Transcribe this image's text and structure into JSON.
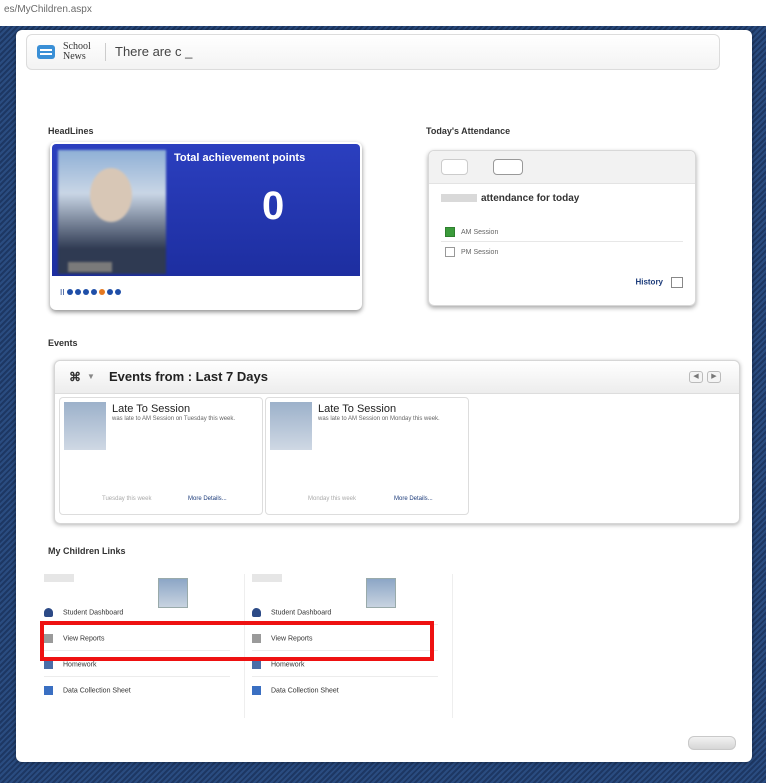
{
  "browser": {
    "url": "es/MyChildren.aspx"
  },
  "school_news": {
    "label": "School News",
    "ticker": "There are c _"
  },
  "sections": {
    "headlines": "HeadLines",
    "attendance": "Today's Attendance",
    "events": "Events",
    "links": "My Children Links"
  },
  "headline": {
    "title": "Total achievement points",
    "value": "0",
    "pause_symbol": "II",
    "dots_total": 7,
    "dots_active_index": 4
  },
  "attendance": {
    "heading": "attendance for today",
    "am_label": "AM Session",
    "am_checked": true,
    "pm_label": "PM Session",
    "pm_checked": false,
    "history_label": "History"
  },
  "events": {
    "title": "Events from : Last 7 Days",
    "filter_icon_glyph": "⌘",
    "cards": [
      {
        "title": "Late To Session",
        "desc": "was late to AM Session on Tuesday this week.",
        "date": "Tuesday this week",
        "more": "More Details..."
      },
      {
        "title": "Late To Session",
        "desc": "was late to AM Session on Monday this week.",
        "date": "Monday this week",
        "more": "More Details..."
      }
    ]
  },
  "links": {
    "children": [
      {
        "items": [
          "Student Dashboard",
          "View Reports",
          "Homework",
          "Data Collection Sheet"
        ]
      },
      {
        "items": [
          "Student Dashboard",
          "View Reports",
          "Homework",
          "Data Collection Sheet"
        ]
      }
    ],
    "icons": [
      "person-icon",
      "report-icon",
      "homework-icon",
      "data-sheet-icon"
    ]
  },
  "colors": {
    "headline_blue": "#2b3fbf",
    "highlight_red": "#ee1111",
    "active_dot": "#e57920",
    "link_blue": "#1c3b7a"
  }
}
